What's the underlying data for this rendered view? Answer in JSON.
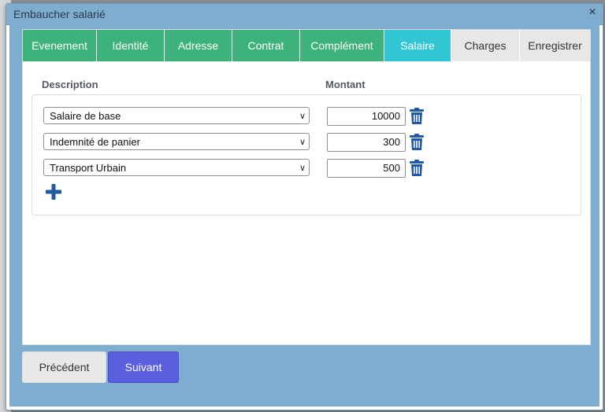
{
  "dialog": {
    "title": "Embaucher salarié",
    "close_label": "×"
  },
  "tabs": [
    {
      "label": "Evenement",
      "state": "done"
    },
    {
      "label": "Identité",
      "state": "done"
    },
    {
      "label": "Adresse",
      "state": "done"
    },
    {
      "label": "Contrat",
      "state": "done"
    },
    {
      "label": "Complément",
      "state": "done"
    },
    {
      "label": "Salaire",
      "state": "active"
    },
    {
      "label": "Charges",
      "state": "todo"
    },
    {
      "label": "Enregistrer",
      "state": "todo"
    }
  ],
  "columns": {
    "description": "Description",
    "amount": "Montant"
  },
  "rows": [
    {
      "description": "Salaire de base",
      "amount": "10000"
    },
    {
      "description": "Indemnité de panier",
      "amount": "300"
    },
    {
      "description": "Transport Urbain",
      "amount": "500"
    }
  ],
  "buttons": {
    "previous": "Précédent",
    "next": "Suivant"
  },
  "icons": {
    "delete": "trash-icon",
    "add": "plus-icon"
  },
  "colors": {
    "tab_done": "#3db27a",
    "tab_active": "#32c6d5",
    "next_button": "#5a5fe0",
    "icon_blue": "#1f5aa6"
  }
}
